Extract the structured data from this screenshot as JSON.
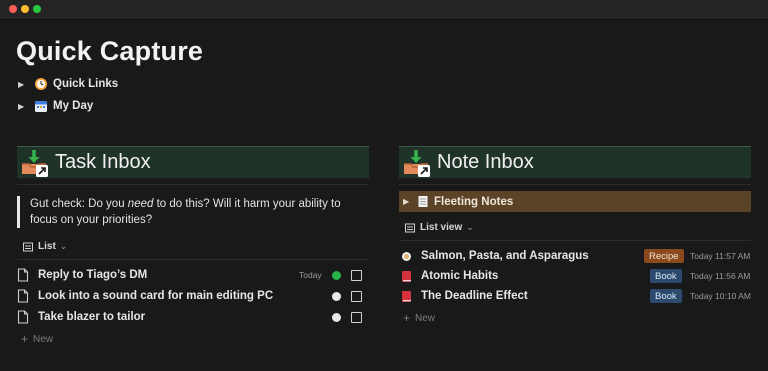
{
  "page": {
    "title": "Quick Capture"
  },
  "toggles": [
    {
      "label": "Quick Links",
      "icon": "clock-icon"
    },
    {
      "label": "My Day",
      "icon": "calendar-icon"
    }
  ],
  "task_inbox": {
    "title": "Task Inbox",
    "quote_pre": "Gut check: Do you ",
    "quote_em": "need",
    "quote_post": " to do this? Will it harm your ability to focus on your priorities?",
    "view_label": "List",
    "tasks": [
      {
        "title": "Reply to Tiago’s DM",
        "date": "Today",
        "status": "green",
        "checked": false
      },
      {
        "title": "Look into a sound card for main editing PC",
        "date": "",
        "status": "grey",
        "checked": false
      },
      {
        "title": "Take blazer to tailor",
        "date": "",
        "status": "grey",
        "checked": false
      }
    ],
    "new_label": "New"
  },
  "note_inbox": {
    "title": "Note Inbox",
    "fleeting_label": "Fleeting Notes",
    "view_label": "List view",
    "notes": [
      {
        "title": "Salmon, Pasta, and Asparagus",
        "tag": "Recipe",
        "time": "Today 11:57 AM",
        "icon": "bowl-icon"
      },
      {
        "title": "Atomic Habits",
        "tag": "Book",
        "time": "Today 11:56 AM",
        "icon": "book-icon"
      },
      {
        "title": "The Deadline Effect",
        "tag": "Book",
        "time": "Today 10:10 AM",
        "icon": "book-icon"
      }
    ],
    "new_label": "New"
  },
  "colors": {
    "background": "#191919",
    "banner": "#1f3329",
    "fleeting": "#5b4327",
    "recipe_tag": "#8a4a1c",
    "book_tag": "#2b4a6e",
    "status_green": "#28b44a"
  }
}
